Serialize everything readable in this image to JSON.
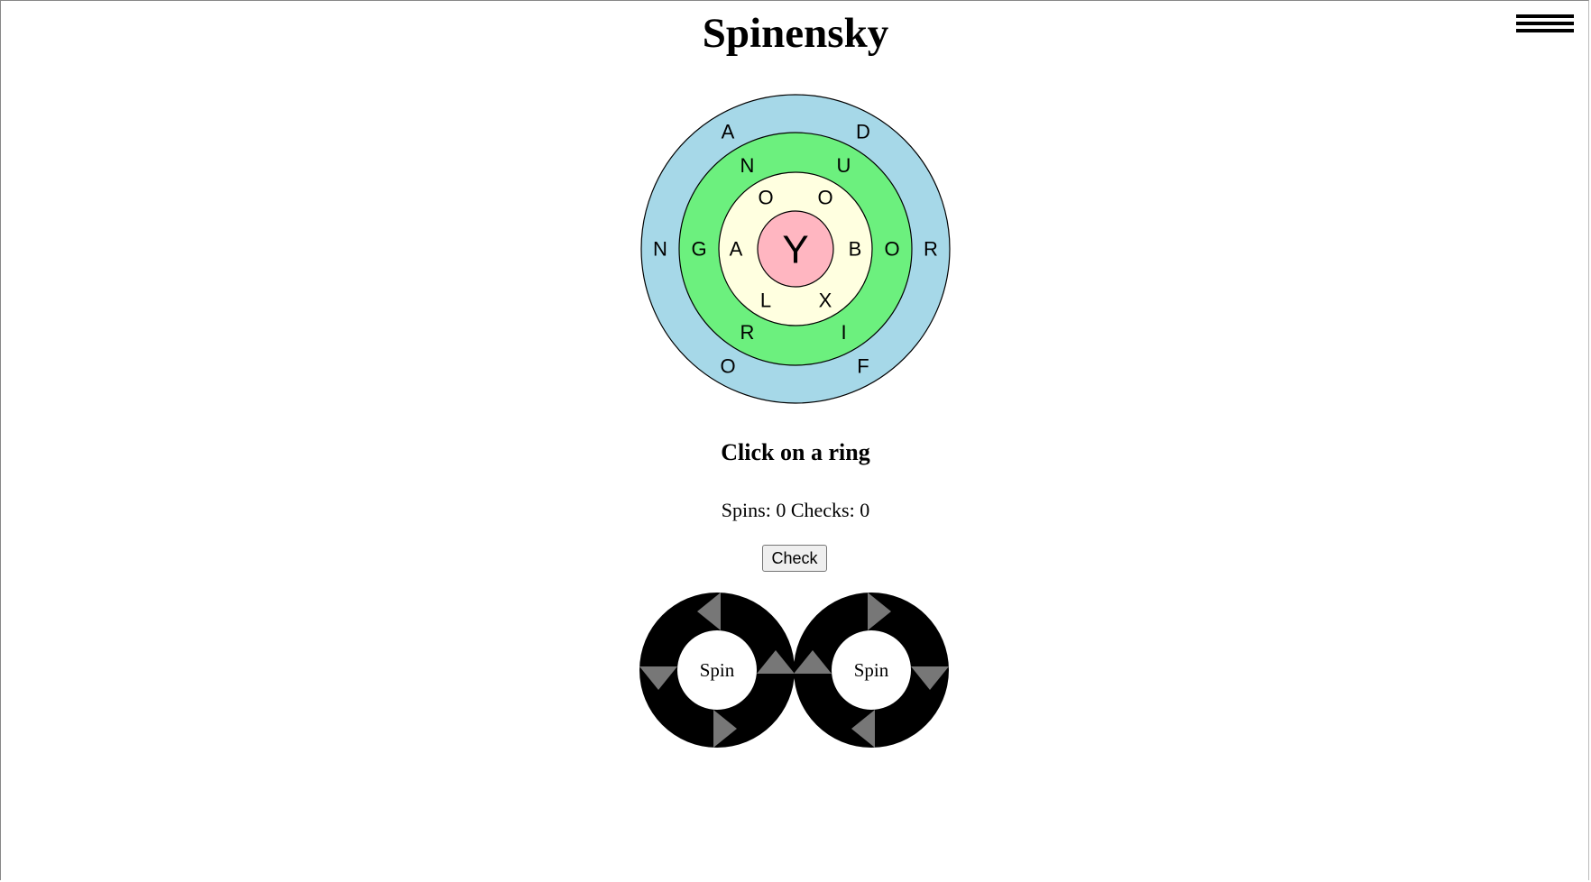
{
  "header": {
    "title": "Spinensky",
    "menu_icon": "hamburger-menu-icon"
  },
  "board": {
    "center": {
      "letter": "Y",
      "color": "#ffb6c1"
    },
    "rings": [
      {
        "name": "inner",
        "color": "#ffffe0",
        "letters": [
          "O",
          "B",
          "X",
          "L",
          "A",
          "O"
        ]
      },
      {
        "name": "middle",
        "color": "#6cf07e",
        "letters": [
          "U",
          "O",
          "I",
          "R",
          "G",
          "N"
        ]
      },
      {
        "name": "outer",
        "color": "#a6d8e8",
        "letters": [
          "D",
          "R",
          "F",
          "O",
          "N",
          "A"
        ]
      }
    ]
  },
  "status": {
    "prompt": "Click on a ring",
    "spins_label": "Spins:",
    "spins": "0",
    "checks_label": "Checks:",
    "checks": "0"
  },
  "controls": {
    "check_label": "Check",
    "spinners": [
      {
        "label": "Spin",
        "direction": "counterclockwise",
        "icon": "rotate-counterclockwise-icon"
      },
      {
        "label": "Spin",
        "direction": "clockwise",
        "icon": "rotate-clockwise-icon"
      }
    ]
  },
  "colors": {
    "spinner_ring": "#000000",
    "spinner_arrow": "#777777"
  }
}
